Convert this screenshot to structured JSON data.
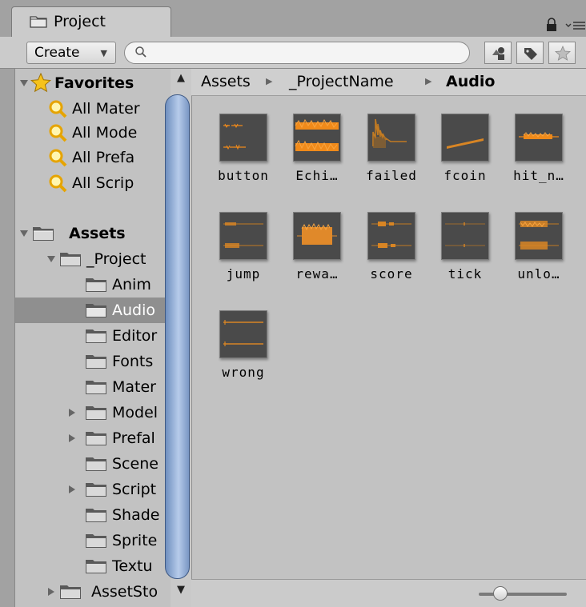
{
  "window": {
    "tab_title": "Project"
  },
  "toolbar": {
    "create_label": "Create",
    "search_placeholder": ""
  },
  "favorites": {
    "label": "Favorites",
    "items": [
      "All Mater",
      "All Mode",
      "All Prefa",
      "All Scrip"
    ]
  },
  "assets_tree": {
    "label": "Assets",
    "project": "_Project",
    "children": [
      "Anim",
      "Audio",
      "Editor",
      "Fonts",
      "Mater",
      "Model",
      "Prefal",
      "Scene",
      "Script",
      "Shade",
      "Sprite",
      "Textu"
    ],
    "asset_store": "AssetSto"
  },
  "breadcrumb": [
    "Assets",
    "_ProjectName",
    "Audio"
  ],
  "audio_assets": [
    "button",
    "Echi…",
    "failed",
    "fcoin",
    "hit_n…",
    "jump",
    "rewa…",
    "score",
    "tick",
    "unlo…",
    "wrong"
  ],
  "colors": {
    "waveform": "#f08a1a",
    "selection": "#8f8f8f",
    "scroll_thumb": "#8fa9d4"
  },
  "icons": {
    "tab": "folder-icon",
    "lock": "lock-icon",
    "menu": "menu-icon",
    "search": "search-icon",
    "filter_type": "filter-type-icon",
    "filter_label": "label-tag-icon",
    "favorite": "star-icon"
  },
  "zoom": {
    "level": 0.2
  }
}
